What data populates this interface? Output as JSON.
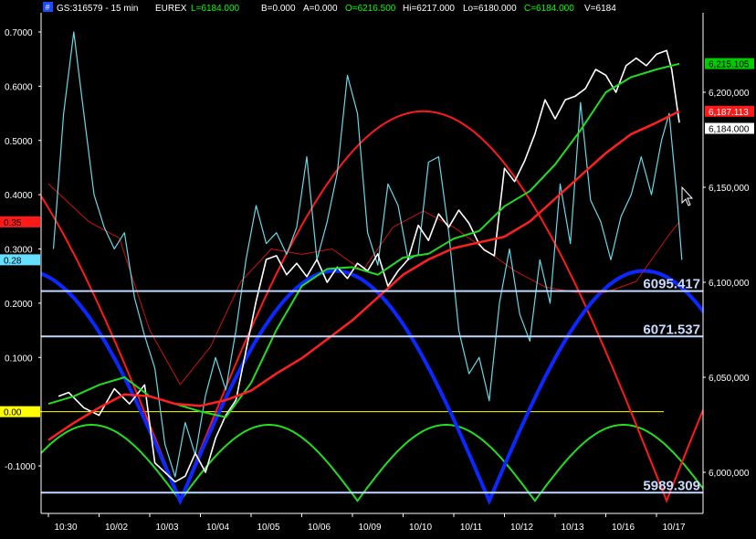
{
  "header": {
    "icon_glyph": "#",
    "symbol": "GS:316579 - 15 min",
    "exchange": "EUREX",
    "last": "L=6184.000",
    "bid": "B=0.000",
    "ask": "A=0.000",
    "open": "O=6216.500",
    "high": "Hi=6217.000",
    "low": "Lo=6180.000",
    "close": "C=6184.000",
    "volume": "V=6184"
  },
  "colors": {
    "background": "#000000",
    "axis_text": "#ffffff",
    "header_green": "#00ff00",
    "price": "#ffffff",
    "oscillator": "#66d9e8",
    "ma_red": "#ff2020",
    "ma_green": "#22dd22",
    "cycle_blue": "#0a28ff",
    "cycle_red": "#ff1a1a",
    "cycle_green": "#22dd22",
    "hline": "#c0d8ff",
    "yellow": "#ffff00"
  },
  "chart_data": {
    "type": "line",
    "x_labels": [
      "10:30",
      "10/02",
      "10/03",
      "10/04",
      "10/05",
      "10/06",
      "10/09",
      "10/10",
      "10/11",
      "10/12",
      "10/13",
      "10/16",
      "10/17"
    ],
    "left_axis": {
      "ticks": [
        "0.7000",
        "0.6000",
        "0.5000",
        "0.4000",
        "0.3000",
        "0.2000",
        "0.1000",
        "0.00",
        "-0.1000"
      ],
      "range": [
        -0.155,
        0.72
      ],
      "markers": [
        {
          "label": "0.35",
          "value": 0.35,
          "color": "#ff1a1a",
          "text_color": "#000000"
        },
        {
          "label": "0.28",
          "value": 0.28,
          "color": "#66e0ff",
          "text_color": "#000000"
        },
        {
          "label": "0.00",
          "value": 0.0,
          "color": "#ffff00",
          "text_color": "#000000"
        }
      ]
    },
    "right_axis": {
      "ticks": [
        "6,200,000",
        "6,150,000",
        "6,100,000",
        "6,050,000",
        "6,000,000"
      ],
      "range": [
        5980,
        6250
      ],
      "markers": [
        {
          "label": "6,215.105",
          "value": 6215.1,
          "color": "#00cc00",
          "text_color": "#000000"
        },
        {
          "label": "6,187.113",
          "value": 6190.0,
          "color": "#ff1a1a",
          "text_color": "#ffffff"
        },
        {
          "label": "6,184.000",
          "value": 6181.0,
          "color": "#ffffff",
          "text_color": "#000000"
        }
      ]
    },
    "levels": [
      {
        "label": "6095.417",
        "value": 6095.4
      },
      {
        "label": "6071.537",
        "value": 6071.5
      },
      {
        "label": "5989.309",
        "value": 5989.3
      }
    ],
    "cycles": [
      {
        "name": "blue",
        "bottoms": [
          2.6,
          8.7,
          12.4
        ],
        "crest": 6106
      },
      {
        "name": "red",
        "bottoms": [
          2.6,
          12.2
        ],
        "crest": 6190
      },
      {
        "name": "green",
        "bottoms": [
          2.6,
          6.1,
          8.7,
          11.8
        ],
        "crest": 6025
      }
    ],
    "price_series": [
      [
        0.2,
        6040
      ],
      [
        0.4,
        6042
      ],
      [
        0.7,
        6034
      ],
      [
        1.0,
        6030
      ],
      [
        1.3,
        6044
      ],
      [
        1.6,
        6036
      ],
      [
        1.9,
        6046
      ],
      [
        2.1,
        6005
      ],
      [
        2.3,
        6000
      ],
      [
        2.5,
        5995
      ],
      [
        2.7,
        5998
      ],
      [
        2.9,
        6010
      ],
      [
        3.1,
        6000
      ],
      [
        3.3,
        6018
      ],
      [
        3.5,
        6030
      ],
      [
        3.7,
        6038
      ],
      [
        3.9,
        6064
      ],
      [
        4.1,
        6090
      ],
      [
        4.3,
        6112
      ],
      [
        4.5,
        6114
      ],
      [
        4.7,
        6104
      ],
      [
        4.9,
        6110
      ],
      [
        5.1,
        6103
      ],
      [
        5.3,
        6112
      ],
      [
        5.5,
        6100
      ],
      [
        5.7,
        6108
      ],
      [
        5.9,
        6102
      ],
      [
        6.1,
        6110
      ],
      [
        6.3,
        6106
      ],
      [
        6.5,
        6115
      ],
      [
        6.7,
        6098
      ],
      [
        6.9,
        6106
      ],
      [
        7.1,
        6112
      ],
      [
        7.3,
        6130
      ],
      [
        7.5,
        6122
      ],
      [
        7.7,
        6136
      ],
      [
        7.9,
        6129
      ],
      [
        8.1,
        6138
      ],
      [
        8.3,
        6131
      ],
      [
        8.5,
        6120
      ],
      [
        8.6,
        6117
      ],
      [
        8.8,
        6114
      ],
      [
        9.0,
        6160
      ],
      [
        9.2,
        6153
      ],
      [
        9.4,
        6164
      ],
      [
        9.6,
        6178
      ],
      [
        9.8,
        6196
      ],
      [
        10.0,
        6186
      ],
      [
        10.2,
        6196
      ],
      [
        10.4,
        6198
      ],
      [
        10.6,
        6202
      ],
      [
        10.8,
        6212
      ],
      [
        11.0,
        6209
      ],
      [
        11.2,
        6200
      ],
      [
        11.4,
        6214
      ],
      [
        11.6,
        6218
      ],
      [
        11.8,
        6214
      ],
      [
        12.0,
        6220
      ],
      [
        12.2,
        6222
      ],
      [
        12.3,
        6212
      ],
      [
        12.45,
        6184
      ]
    ],
    "oscillator_series": [
      [
        0.1,
        0.3
      ],
      [
        0.3,
        0.55
      ],
      [
        0.5,
        0.7
      ],
      [
        0.7,
        0.55
      ],
      [
        0.9,
        0.4
      ],
      [
        1.1,
        0.34
      ],
      [
        1.3,
        0.3
      ],
      [
        1.5,
        0.33
      ],
      [
        1.7,
        0.21
      ],
      [
        1.9,
        0.14
      ],
      [
        2.1,
        0.08
      ],
      [
        2.3,
        -0.06
      ],
      [
        2.5,
        -0.12
      ],
      [
        2.7,
        -0.02
      ],
      [
        2.9,
        -0.08
      ],
      [
        3.1,
        0.03
      ],
      [
        3.3,
        0.1
      ],
      [
        3.5,
        0.04
      ],
      [
        3.7,
        0.15
      ],
      [
        3.9,
        0.28
      ],
      [
        4.1,
        0.38
      ],
      [
        4.3,
        0.31
      ],
      [
        4.5,
        0.33
      ],
      [
        4.7,
        0.29
      ],
      [
        4.9,
        0.34
      ],
      [
        5.1,
        0.47
      ],
      [
        5.3,
        0.28
      ],
      [
        5.5,
        0.35
      ],
      [
        5.7,
        0.44
      ],
      [
        5.9,
        0.62
      ],
      [
        6.1,
        0.55
      ],
      [
        6.3,
        0.33
      ],
      [
        6.5,
        0.27
      ],
      [
        6.7,
        0.42
      ],
      [
        6.9,
        0.38
      ],
      [
        7.1,
        0.28
      ],
      [
        7.3,
        0.29
      ],
      [
        7.5,
        0.46
      ],
      [
        7.7,
        0.47
      ],
      [
        7.9,
        0.33
      ],
      [
        8.1,
        0.15
      ],
      [
        8.3,
        0.07
      ],
      [
        8.5,
        0.1
      ],
      [
        8.7,
        0.02
      ],
      [
        8.9,
        0.2
      ],
      [
        9.1,
        0.3
      ],
      [
        9.3,
        0.18
      ],
      [
        9.5,
        0.13
      ],
      [
        9.7,
        0.28
      ],
      [
        9.9,
        0.2
      ],
      [
        10.1,
        0.42
      ],
      [
        10.3,
        0.31
      ],
      [
        10.5,
        0.57
      ],
      [
        10.7,
        0.39
      ],
      [
        10.9,
        0.35
      ],
      [
        11.1,
        0.28
      ],
      [
        11.3,
        0.36
      ],
      [
        11.5,
        0.4
      ],
      [
        11.7,
        0.47
      ],
      [
        11.9,
        0.4
      ],
      [
        12.1,
        0.5
      ],
      [
        12.25,
        0.55
      ],
      [
        12.4,
        0.4
      ],
      [
        12.5,
        0.28
      ]
    ],
    "ma_red_series": [
      [
        0.0,
        6017
      ],
      [
        0.5,
        6026
      ],
      [
        1.0,
        6034
      ],
      [
        1.5,
        6041
      ],
      [
        2.0,
        6040
      ],
      [
        2.5,
        6036
      ],
      [
        3.0,
        6035
      ],
      [
        3.5,
        6038
      ],
      [
        4.0,
        6043
      ],
      [
        4.5,
        6052
      ],
      [
        5.0,
        6060
      ],
      [
        5.5,
        6070
      ],
      [
        6.0,
        6080
      ],
      [
        6.5,
        6092
      ],
      [
        7.0,
        6104
      ],
      [
        7.5,
        6112
      ],
      [
        8.0,
        6118
      ],
      [
        8.5,
        6121
      ],
      [
        9.0,
        6124
      ],
      [
        9.5,
        6132
      ],
      [
        10.0,
        6144
      ],
      [
        10.5,
        6156
      ],
      [
        11.0,
        6168
      ],
      [
        11.5,
        6178
      ],
      [
        12.0,
        6184
      ],
      [
        12.45,
        6190
      ]
    ],
    "ma_green_series": [
      [
        0.0,
        6036
      ],
      [
        0.5,
        6040
      ],
      [
        1.0,
        6046
      ],
      [
        1.5,
        6050
      ],
      [
        2.0,
        6040
      ],
      [
        2.5,
        6036
      ],
      [
        3.0,
        6032
      ],
      [
        3.5,
        6029
      ],
      [
        4.0,
        6047
      ],
      [
        4.5,
        6075
      ],
      [
        5.0,
        6098
      ],
      [
        5.5,
        6107
      ],
      [
        6.0,
        6108
      ],
      [
        6.5,
        6104
      ],
      [
        7.0,
        6113
      ],
      [
        7.5,
        6115
      ],
      [
        8.0,
        6123
      ],
      [
        8.5,
        6127
      ],
      [
        9.0,
        6140
      ],
      [
        9.5,
        6148
      ],
      [
        10.0,
        6162
      ],
      [
        10.5,
        6180
      ],
      [
        11.0,
        6200
      ],
      [
        11.5,
        6208
      ],
      [
        12.0,
        6212
      ],
      [
        12.45,
        6215
      ]
    ],
    "thin_red_series": [
      [
        0.0,
        0.42
      ],
      [
        0.8,
        0.35
      ],
      [
        1.4,
        0.32
      ],
      [
        2.0,
        0.15
      ],
      [
        2.6,
        0.05
      ],
      [
        3.2,
        0.12
      ],
      [
        3.8,
        0.24
      ],
      [
        4.4,
        0.3
      ],
      [
        5.0,
        0.29
      ],
      [
        5.6,
        0.3
      ],
      [
        6.2,
        0.26
      ],
      [
        6.8,
        0.34
      ],
      [
        7.4,
        0.37
      ],
      [
        8.0,
        0.34
      ],
      [
        8.6,
        0.3
      ],
      [
        9.2,
        0.26
      ],
      [
        9.8,
        0.23
      ],
      [
        10.4,
        0.22
      ],
      [
        11.0,
        0.22
      ],
      [
        11.6,
        0.24
      ],
      [
        12.2,
        0.32
      ],
      [
        12.45,
        0.35
      ]
    ]
  }
}
